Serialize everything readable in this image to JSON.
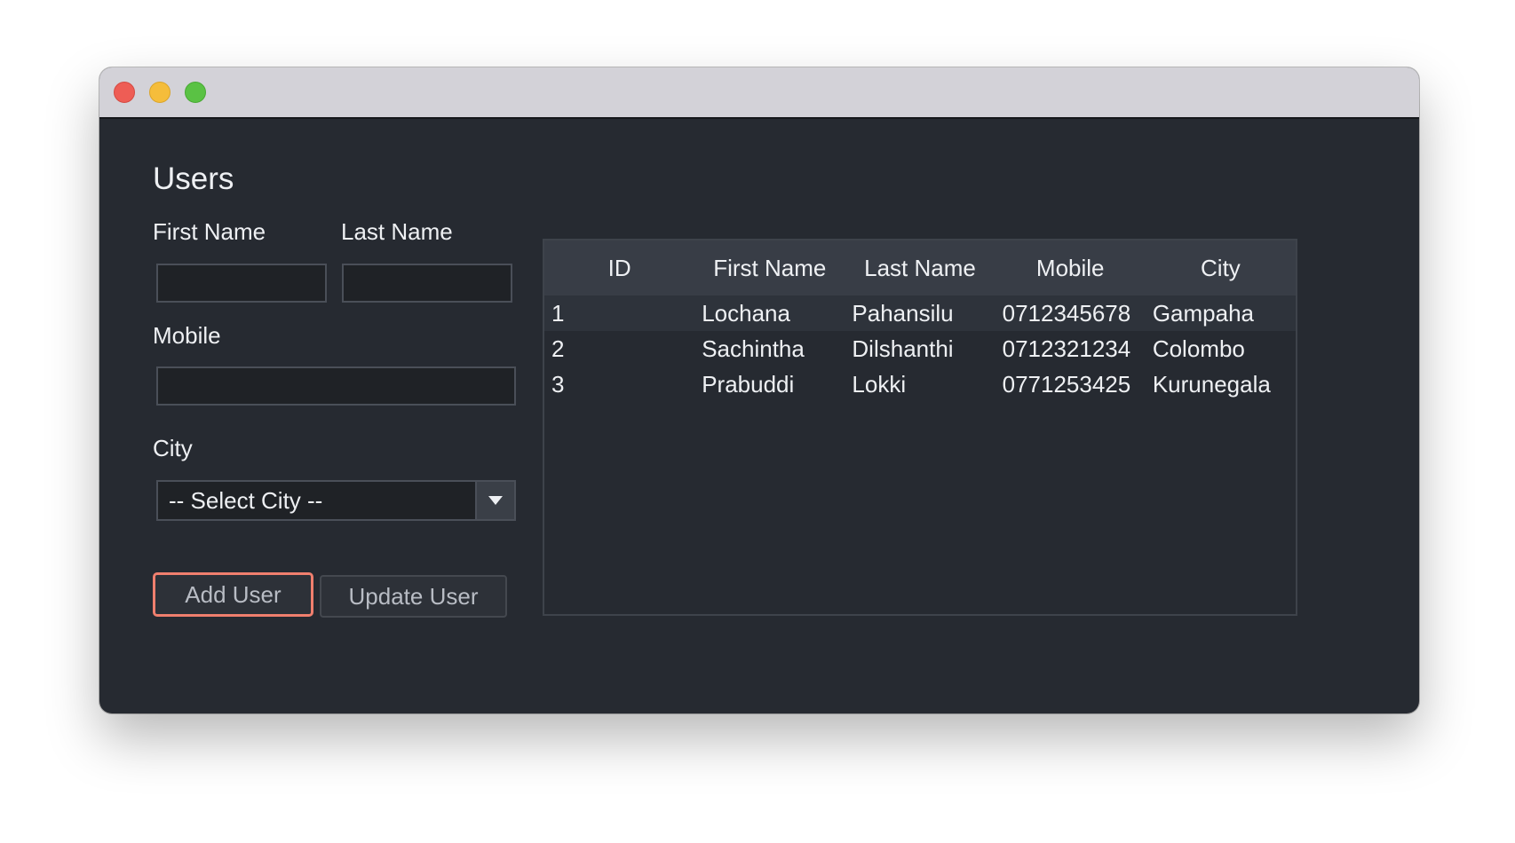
{
  "window": {
    "controls": [
      "close",
      "minimize",
      "maximize"
    ]
  },
  "page": {
    "title": "Users"
  },
  "form": {
    "first_name_label": "First Name",
    "first_name_value": "",
    "last_name_label": "Last Name",
    "last_name_value": "",
    "mobile_label": "Mobile",
    "mobile_value": "",
    "city_label": "City",
    "city_selected": "-- Select City --"
  },
  "buttons": {
    "add_label": "Add User",
    "update_label": "Update User"
  },
  "table": {
    "columns": [
      "ID",
      "First Name",
      "Last Name",
      "Mobile",
      "City"
    ],
    "rows": [
      {
        "id": "1",
        "first_name": "Lochana",
        "last_name": "Pahansilu",
        "mobile": "0712345678",
        "city": "Gampaha"
      },
      {
        "id": "2",
        "first_name": "Sachintha",
        "last_name": "Dilshanthi",
        "mobile": "0712321234",
        "city": "Colombo"
      },
      {
        "id": "3",
        "first_name": "Prabuddi",
        "last_name": "Lokki",
        "mobile": "0771253425",
        "city": "Kurunegala"
      }
    ],
    "selected_row": 0
  },
  "colors": {
    "background": "#262a31",
    "titlebar": "#d3d2d8",
    "focus_ring": "#f07f6e",
    "header": "#383d46"
  }
}
